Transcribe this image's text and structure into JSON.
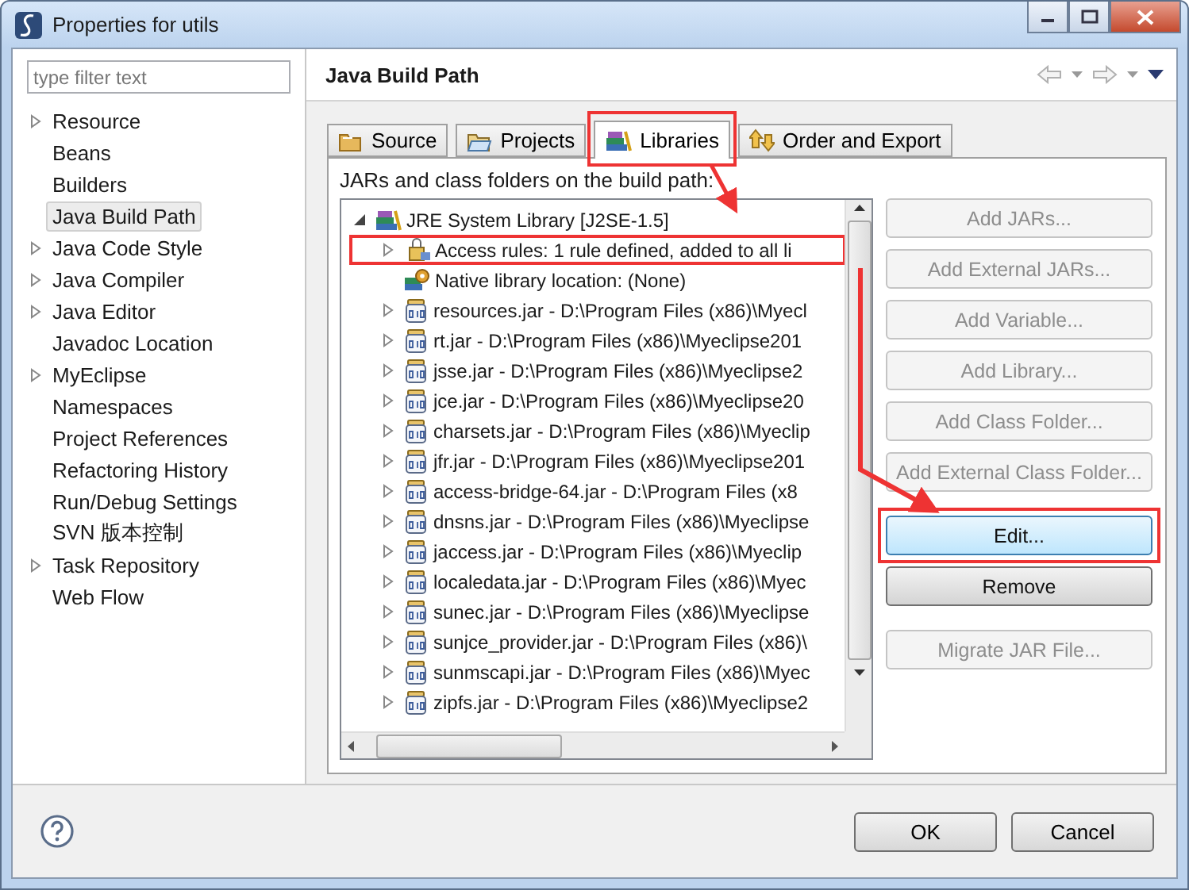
{
  "window": {
    "title": "Properties for utils"
  },
  "sidebar": {
    "filter": {
      "placeholder": "type filter text"
    },
    "items": [
      {
        "label": "Resource",
        "expanded": false,
        "selected": false
      },
      {
        "label": "Beans",
        "selected": false
      },
      {
        "label": "Builders",
        "selected": false
      },
      {
        "label": "Java Build Path",
        "selected": true
      },
      {
        "label": "Java Code Style",
        "expanded": false,
        "selected": false
      },
      {
        "label": "Java Compiler",
        "expanded": false,
        "selected": false
      },
      {
        "label": "Java Editor",
        "expanded": false,
        "selected": false
      },
      {
        "label": "Javadoc Location",
        "selected": false
      },
      {
        "label": "MyEclipse",
        "expanded": false,
        "selected": false
      },
      {
        "label": "Namespaces",
        "selected": false
      },
      {
        "label": "Project References",
        "selected": false
      },
      {
        "label": "Refactoring History",
        "selected": false
      },
      {
        "label": "Run/Debug Settings",
        "selected": false
      },
      {
        "label": "SVN 版本控制",
        "selected": false
      },
      {
        "label": "Task Repository",
        "expanded": false,
        "selected": false
      },
      {
        "label": "Web Flow",
        "selected": false
      }
    ]
  },
  "page": {
    "title": "Java Build Path",
    "tabs": [
      {
        "label": "Source",
        "kind": "source",
        "selected": false
      },
      {
        "label": "Projects",
        "kind": "projects",
        "selected": false
      },
      {
        "label": "Libraries",
        "kind": "libraries",
        "selected": true
      },
      {
        "label": "Order and Export",
        "kind": "order",
        "selected": false
      }
    ],
    "caption": "JARs and class folders on the build path:",
    "tree": [
      {
        "label": "JRE System Library [J2SE-1.5]",
        "kind": "library",
        "expanded": true,
        "children": [
          {
            "label": "Access rules: 1 rule defined, added to all li",
            "kind": "access",
            "expanded": false
          },
          {
            "label": "Native library location: (None)",
            "kind": "native"
          },
          {
            "label": "resources.jar - D:\\Program Files (x86)\\Myecl",
            "kind": "jar",
            "expanded": false
          },
          {
            "label": "rt.jar - D:\\Program Files (x86)\\Myeclipse201",
            "kind": "jar",
            "expanded": false
          },
          {
            "label": "jsse.jar - D:\\Program Files (x86)\\Myeclipse2",
            "kind": "jar",
            "expanded": false
          },
          {
            "label": "jce.jar - D:\\Program Files (x86)\\Myeclipse20",
            "kind": "jar",
            "expanded": false
          },
          {
            "label": "charsets.jar - D:\\Program Files (x86)\\Myeclip",
            "kind": "jar",
            "expanded": false
          },
          {
            "label": "jfr.jar - D:\\Program Files (x86)\\Myeclipse201",
            "kind": "jar",
            "expanded": false
          },
          {
            "label": "access-bridge-64.jar - D:\\Program Files (x8",
            "kind": "jar",
            "expanded": false
          },
          {
            "label": "dnsns.jar - D:\\Program Files (x86)\\Myeclipse",
            "kind": "jar",
            "expanded": false
          },
          {
            "label": "jaccess.jar - D:\\Program Files (x86)\\Myeclip",
            "kind": "jar",
            "expanded": false
          },
          {
            "label": "localedata.jar - D:\\Program Files (x86)\\Myec",
            "kind": "jar",
            "expanded": false
          },
          {
            "label": "sunec.jar - D:\\Program Files (x86)\\Myeclipse",
            "kind": "jar",
            "expanded": false
          },
          {
            "label": "sunjce_provider.jar - D:\\Program Files (x86)\\",
            "kind": "jar",
            "expanded": false
          },
          {
            "label": "sunmscapi.jar - D:\\Program Files (x86)\\Myec",
            "kind": "jar",
            "expanded": false
          },
          {
            "label": "zipfs.jar - D:\\Program Files (x86)\\Myeclipse2",
            "kind": "jar",
            "expanded": false
          }
        ]
      }
    ],
    "button_groups": [
      [
        {
          "label": "Add JARs...",
          "disabled": true,
          "focused": false
        },
        {
          "label": "Add External JARs...",
          "disabled": true,
          "focused": false
        },
        {
          "label": "Add Variable...",
          "disabled": true,
          "focused": false
        },
        {
          "label": "Add Library...",
          "disabled": true,
          "focused": false
        },
        {
          "label": "Add Class Folder...",
          "disabled": true,
          "focused": false
        },
        {
          "label": "Add External Class Folder...",
          "disabled": true,
          "focused": false
        }
      ],
      [
        {
          "label": "Edit...",
          "disabled": false,
          "focused": true
        },
        {
          "label": "Remove",
          "disabled": false,
          "focused": false
        }
      ],
      [
        {
          "label": "Migrate JAR File...",
          "disabled": true,
          "focused": false
        }
      ]
    ]
  },
  "footer": {
    "buttons": [
      "OK",
      "Cancel"
    ]
  }
}
